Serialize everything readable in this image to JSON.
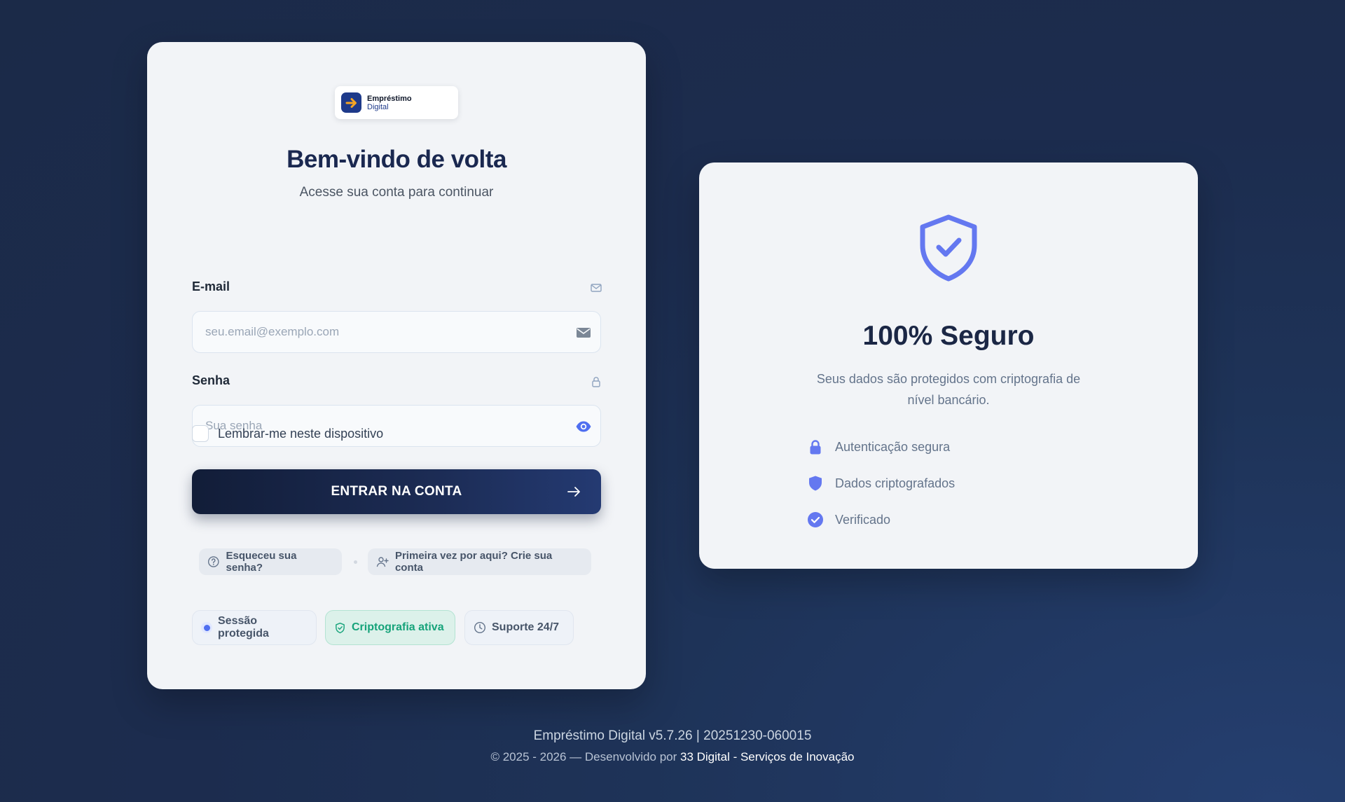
{
  "brand": {
    "name_line1": "Empréstimo",
    "name_line2": "Digital",
    "accent_color": "#1e3a8a",
    "logo_arrow_color": "#f5a524"
  },
  "login": {
    "title": "Bem-vindo de volta",
    "subtitle": "Acesse sua conta para continuar",
    "email": {
      "label": "E-mail",
      "placeholder": "seu.email@exemplo.com",
      "value": "",
      "label_icon": "envelope-icon",
      "input_icon": "envelope-icon"
    },
    "password": {
      "label": "Senha",
      "placeholder": "Sua senha",
      "value": "",
      "label_icon": "lock-icon",
      "input_icon": "eye-icon"
    },
    "remember": {
      "label": "Lembrar-me neste dispositivo",
      "checked": false
    },
    "submit_label": "ENTRAR NA CONTA",
    "links": {
      "forgot": "Esqueceu sua senha?",
      "signup": "Primeira vez por aqui? Crie sua conta"
    },
    "status": {
      "session": "Sessão protegida",
      "crypto": "Criptografia ativa",
      "support": "Suporte 24/7"
    }
  },
  "security": {
    "icon": "shield-check-icon",
    "title": "100% Seguro",
    "description": "Seus dados são protegidos com criptografia de nível bancário.",
    "features": [
      {
        "icon": "lock-icon",
        "label": "Autenticação segura"
      },
      {
        "icon": "shield-icon",
        "label": "Dados criptografados"
      },
      {
        "icon": "check-circle-icon",
        "label": "Verificado"
      }
    ],
    "accent_color": "#6478f0"
  },
  "footer": {
    "version": "Empréstimo Digital v5.7.26 | 20251230-060015",
    "copyright_prefix": "© 2025 - 2026 — Desenvolvido por ",
    "company": "33 Digital - Serviços de Inovação"
  }
}
